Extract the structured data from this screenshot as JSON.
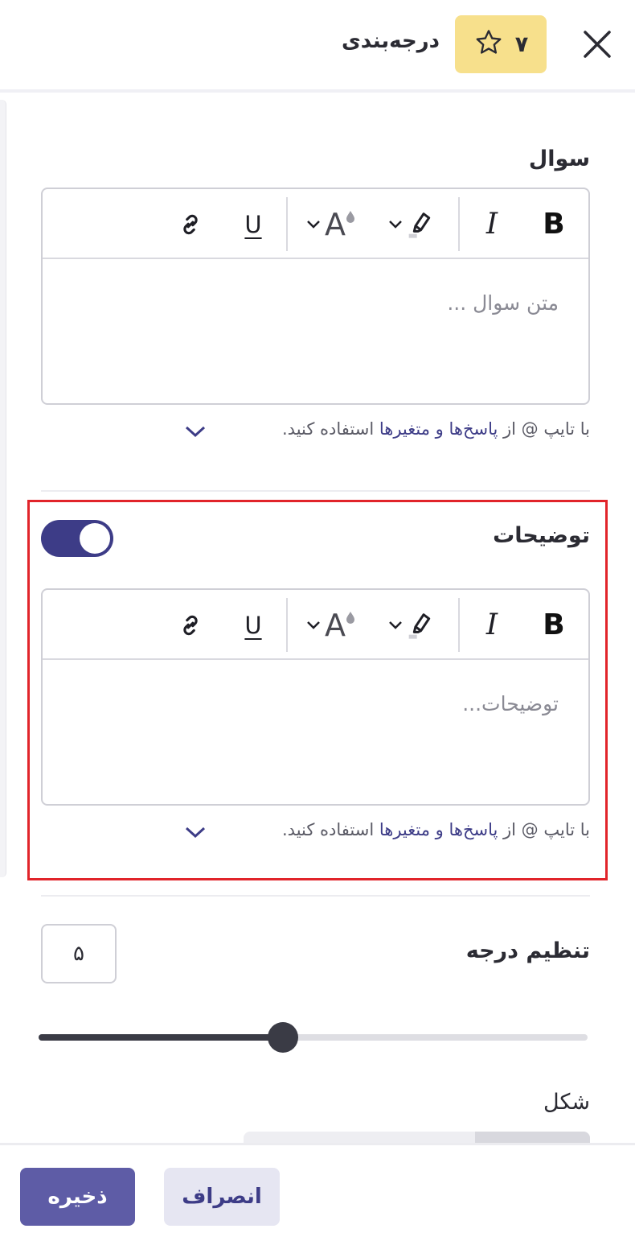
{
  "header": {
    "title": "درجه‌بندی",
    "badge_number": "۷",
    "badge_color": "#f7e08c"
  },
  "question": {
    "label": "سوال",
    "placeholder": "متن سوال ...",
    "hint_prefix": "با تایپ @ از ",
    "hint_link": "پاسخ‌ها و متغیرها",
    "hint_suffix": " استفاده کنید."
  },
  "description": {
    "label": "توضیحات",
    "toggle_on": true,
    "placeholder": "توضیحات...",
    "hint_prefix": "با تایپ @ از ",
    "hint_link": "پاسخ‌ها و متغیرها",
    "hint_suffix": " استفاده کنید."
  },
  "toolbar": {
    "bold": "B",
    "italic": "I",
    "underline": "U",
    "font_color": "A",
    "icons": [
      "bold-icon",
      "italic-icon",
      "highlight-icon",
      "font-color-icon",
      "underline-icon",
      "link-icon"
    ]
  },
  "degree": {
    "label": "تنظیم درجه",
    "value": "۵",
    "slider_fraction": 0.44
  },
  "shape": {
    "label": "شکل"
  },
  "footer": {
    "save_label": "ذخیره",
    "cancel_label": "انصراف"
  },
  "colors": {
    "accent": "#3d3c87",
    "save_button": "#5e5ca6",
    "highlight_border": "#e1242a"
  }
}
